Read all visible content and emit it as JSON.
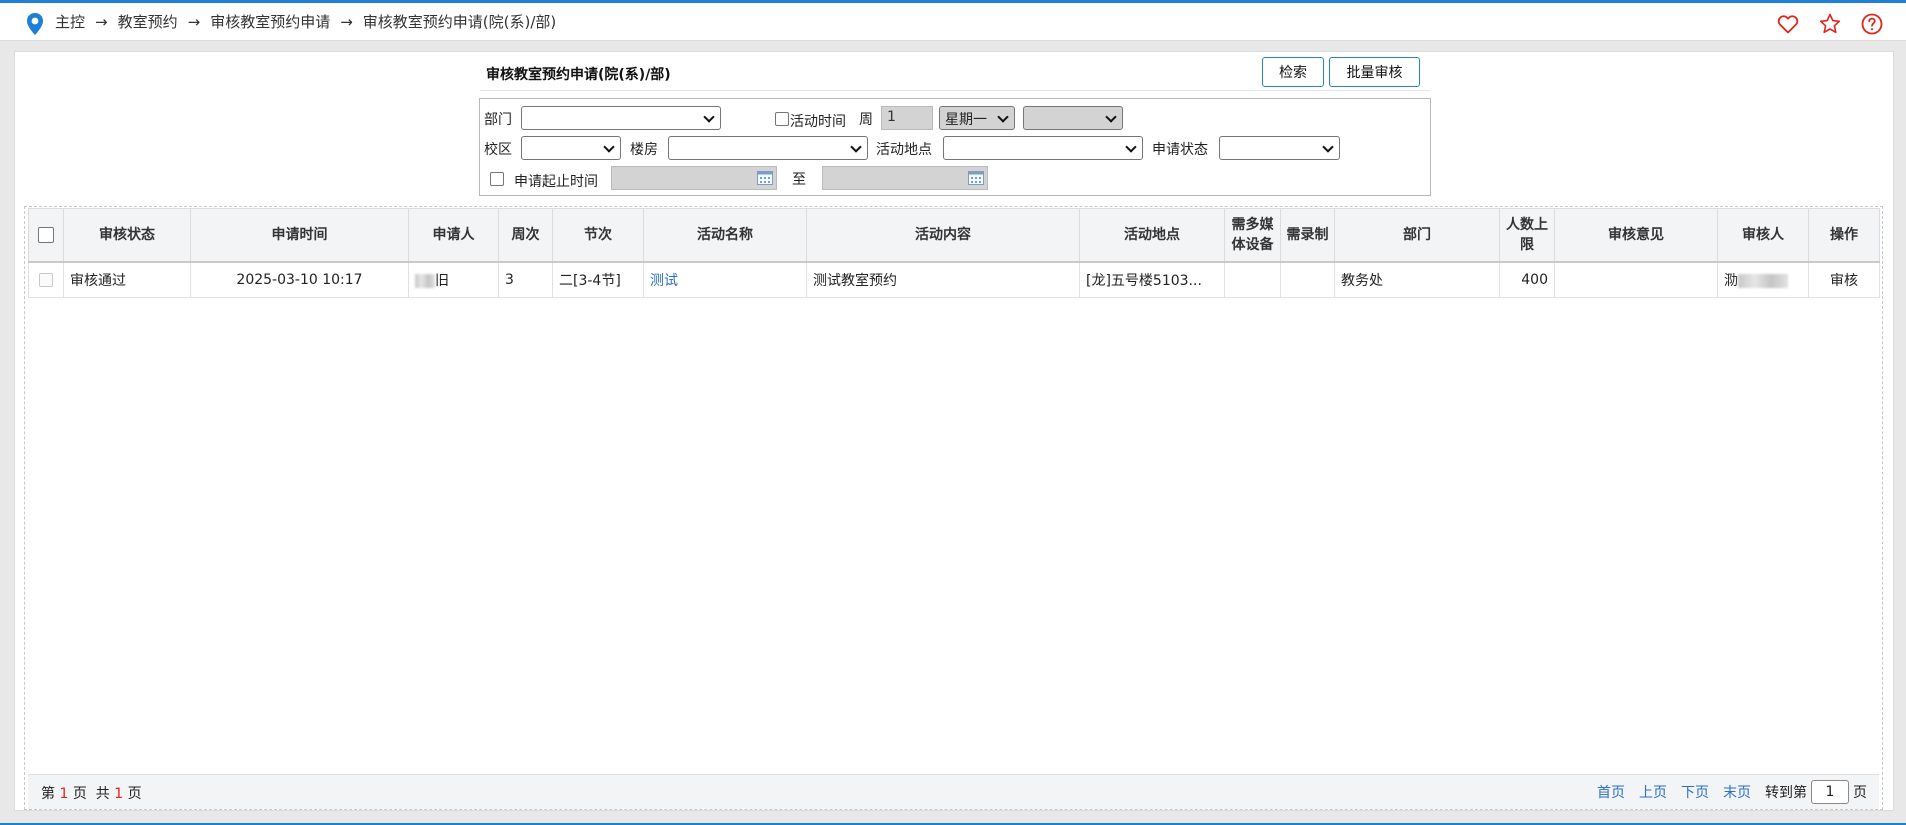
{
  "breadcrumb": {
    "items": [
      "主控",
      "教室预约",
      "审核教室预约申请",
      "审核教室预约申请(院(系)/部)"
    ],
    "separator": "→"
  },
  "top_icons": [
    "heart-icon",
    "star-icon",
    "help-icon"
  ],
  "form": {
    "title": "审核教室预约申请(院(系)/部)",
    "search_button": "检索",
    "batch_button": "批量审核",
    "dept_label": "部门",
    "activity_time_label": "活动时间",
    "week_label": "周",
    "week_value": "1",
    "weekday_value": "星期一",
    "campus_label": "校区",
    "building_label": "楼房",
    "location_label": "活动地点",
    "status_label": "申请状态",
    "apply_range_label": "申请起止时间",
    "to_label": "至"
  },
  "table": {
    "headers": [
      "审核状态",
      "申请时间",
      "申请人",
      "周次",
      "节次",
      "活动名称",
      "活动内容",
      "活动地点",
      "需多媒体设备",
      "需录制",
      "部门",
      "人数上限",
      "审核意见",
      "审核人",
      "操作"
    ],
    "rows": [
      {
        "status": "审核通过",
        "apply_time": "2025-03-10 10:17",
        "applicant_suffix": "旧",
        "week": "3",
        "section": "二[3-4节]",
        "activity_name": "测试",
        "activity_content": "测试教室预约",
        "location": "[龙]五号楼5103...",
        "multimedia": "",
        "record": "",
        "department": "教务处",
        "capacity": "400",
        "opinion": "",
        "reviewer_prefix": "泐",
        "action": "审核"
      }
    ]
  },
  "pagination": {
    "page_prefix": "第",
    "current_page": "1",
    "page_suffix": "页",
    "total_prefix": "共",
    "total_pages": "1",
    "total_suffix": "页",
    "first": "首页",
    "prev": "上页",
    "next": "下页",
    "last": "末页",
    "goto_label": "转到第",
    "goto_value": "1",
    "goto_suffix": "页"
  },
  "colors": {
    "accent": "#1e7fd8",
    "link": "#2a70c8",
    "icon_red": "#e0241b"
  }
}
